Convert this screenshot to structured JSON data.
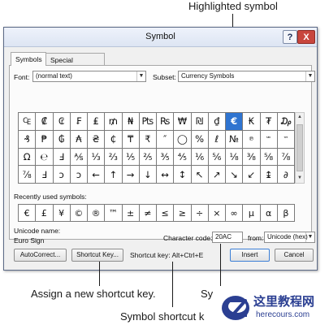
{
  "callouts": {
    "highlighted": "Highlighted symbol",
    "assign": "Assign a new shortcut key.",
    "shortcut_prefix": "Symbol shortcut k",
    "right_partial": "Sy"
  },
  "dialog": {
    "title": "Symbol",
    "help_label": "?",
    "close_label": "X",
    "tabs": [
      {
        "label": "Symbols"
      },
      {
        "label": "Special Characters"
      }
    ]
  },
  "font_row": {
    "font_label": "Font:",
    "font_value": "(normal text)",
    "subset_label": "Subset:",
    "subset_value": "Currency Symbols"
  },
  "symbol_grid": {
    "selected": "€",
    "rows": [
      [
        "₠",
        "₡",
        "₢",
        "₣",
        "₤",
        "₥",
        "₦",
        "₧",
        "₨",
        "₩",
        "₪",
        "₫",
        "€",
        "₭",
        "₮",
        "₯"
      ],
      [
        "₰",
        "₱",
        "₲",
        "₳",
        "₴",
        "₵",
        "₸",
        "₹",
        "″",
        "◯",
        "%",
        "ℓ",
        "№",
        "℗",
        "℠",
        "™"
      ],
      [
        "Ω",
        "℮",
        "Ⅎ",
        "⅍",
        "⅓",
        "⅔",
        "⅕",
        "⅖",
        "⅗",
        "⅘",
        "⅙",
        "⅚",
        "⅛",
        "⅜",
        "⅝",
        "⅞"
      ],
      [
        "⅞",
        "Ⅎ",
        "ↄ",
        "ↄ",
        "←",
        "↑",
        "→",
        "↓",
        "↔",
        "↕",
        "↖",
        "↗",
        "↘",
        "↙",
        "↨",
        "∂"
      ]
    ]
  },
  "recent": {
    "label": "Recently used symbols:",
    "symbols": [
      "€",
      "£",
      "¥",
      "©",
      "®",
      "™",
      "±",
      "≠",
      "≤",
      "≥",
      "÷",
      "×",
      "∞",
      "µ",
      "α",
      "β"
    ]
  },
  "info": {
    "unicode_name_label": "Unicode name:",
    "unicode_name_value": "Euro Sign",
    "char_code_label": "Character code:",
    "char_code_value": "20AC",
    "from_label": "from:",
    "from_value": "Unicode (hex)"
  },
  "buttons": {
    "autocorrect": "AutoCorrect...",
    "shortcut_key": "Shortcut Key...",
    "shortcut_text": "Shortcut key: Alt+Ctrl+E",
    "insert": "Insert",
    "cancel": "Cancel"
  },
  "watermark": {
    "cn": "这里教程网",
    "url": "herecours.com"
  }
}
